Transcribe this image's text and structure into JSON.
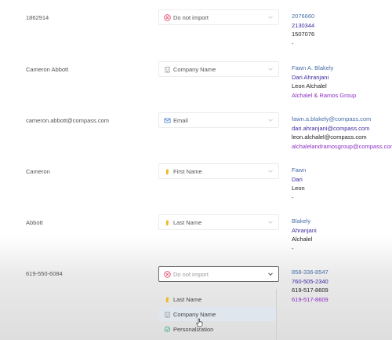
{
  "rows": [
    {
      "source": "1862914",
      "mapping": {
        "label": "Do not import",
        "icon": "do-not-import-icon"
      },
      "values": [
        "2076660",
        "2130344",
        "1507076",
        "-"
      ]
    },
    {
      "source": "Cameron Abbott",
      "mapping": {
        "label": "Company Name",
        "icon": "building-icon"
      },
      "values": [
        "Fawn A. Blakely",
        "Dari Ahranjani",
        "Leon Alchalel",
        "Alchalel & Ramos Group"
      ]
    },
    {
      "source": "cameron.abbott@compass.com",
      "mapping": {
        "label": "Email",
        "icon": "envelope-icon"
      },
      "values": [
        "fawn.a.blakely@compass.com",
        "dari.ahranjani@compass.com",
        "leon.alchalel@compass.com",
        "alchalelandramosgroup@compass.com"
      ]
    },
    {
      "source": "Cameron",
      "mapping": {
        "label": "First Name",
        "icon": "person-icon"
      },
      "values": [
        "Fawn",
        "Dari",
        "Leon",
        "-"
      ]
    },
    {
      "source": "Abbott",
      "mapping": {
        "label": "Last Name",
        "icon": "person-icon"
      },
      "values": [
        "Blakely",
        "Ahranjani",
        "Alchalel",
        "-"
      ]
    },
    {
      "source": "619-550-6084",
      "mapping": {
        "label": "Do not import",
        "icon": "do-not-import-icon"
      },
      "values": [
        "858-336-8547",
        "760-505-2340",
        "619-517-8609",
        "619-517-8609"
      ]
    }
  ],
  "dropdown": {
    "items": [
      {
        "label": "Last Name",
        "icon": "person-icon"
      },
      {
        "label": "Company Name",
        "icon": "building-icon",
        "highlighted": true
      },
      {
        "label": "Personalization",
        "icon": "chat-icon"
      }
    ]
  },
  "colors": {
    "do_not_import": "#e0456b",
    "email_icon": "#4a7fd0",
    "person_icon": "#f2b824",
    "highlight": "#dfe6ee",
    "personalization_icon": "#3fb08a"
  }
}
